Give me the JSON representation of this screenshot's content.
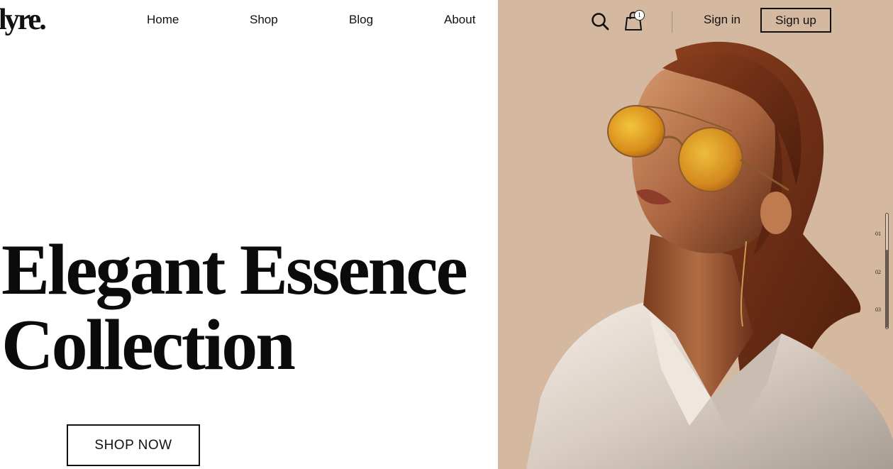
{
  "header": {
    "logo": "lyre.",
    "nav": [
      {
        "label": "Home"
      },
      {
        "label": "Shop"
      },
      {
        "label": "Blog"
      },
      {
        "label": "About"
      }
    ],
    "cart_count": "1",
    "sign_in": "Sign in",
    "sign_up": "Sign up",
    "icons": [
      "search-icon",
      "shopping-bag-icon"
    ]
  },
  "hero": {
    "headline_line1": "Elegant Essence",
    "headline_line2": "Collection",
    "cta": "SHOP NOW",
    "image": "woman-with-amber-sunglasses-photo"
  },
  "pager": {
    "slides": [
      "01",
      "02",
      "03"
    ]
  },
  "colors": {
    "panel_bg": "#d5b8a0",
    "text": "#111111",
    "background": "#ffffff"
  }
}
